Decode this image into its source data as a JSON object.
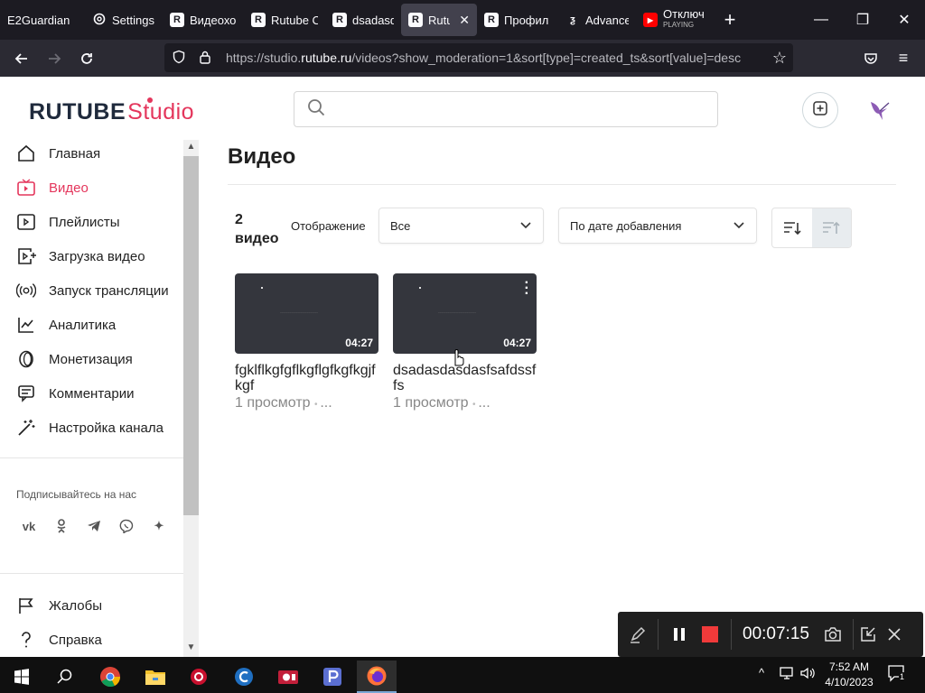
{
  "browser": {
    "tabs": [
      {
        "title": "E2Guardian -",
        "icon": "e2guardian-icon"
      },
      {
        "title": "Settings",
        "icon": "gear-icon"
      },
      {
        "title": "Видеохо",
        "icon": "rutube-icon"
      },
      {
        "title": "Rutube С",
        "icon": "rutube-icon"
      },
      {
        "title": "dsadasda",
        "icon": "rutube-icon"
      },
      {
        "title": "Rutub",
        "icon": "rutube-icon",
        "active": true
      },
      {
        "title": "Профил",
        "icon": "rutube-icon"
      },
      {
        "title": "Advance",
        "icon": "advance-icon"
      },
      {
        "title": "Отключ",
        "subtitle": "PLAYING",
        "icon": "youtube-icon"
      }
    ],
    "url_prefix": "https://studio.",
    "url_domain": "rutube.ru",
    "url_suffix": "/videos?show_moderation=1&sort[type]=created_ts&sort[value]=desc"
  },
  "studio": {
    "logo_main": "RUTUBE",
    "logo_studio": "Studio",
    "search_placeholder": ""
  },
  "sidebar": {
    "items": [
      {
        "label": "Главная",
        "icon": "home-icon"
      },
      {
        "label": "Видео",
        "icon": "video-icon",
        "active": true
      },
      {
        "label": "Плейлисты",
        "icon": "playlist-icon"
      },
      {
        "label": "Загрузка видео",
        "icon": "upload-video-icon"
      },
      {
        "label": "Запуск трансляции",
        "icon": "broadcast-icon"
      },
      {
        "label": "Аналитика",
        "icon": "analytics-icon"
      },
      {
        "label": "Монетизация",
        "icon": "monetization-icon"
      },
      {
        "label": "Комментарии",
        "icon": "comments-icon"
      },
      {
        "label": "Настройка канала",
        "icon": "channel-settings-icon"
      }
    ],
    "follow_label": "Подписывайтесь на нас",
    "social": [
      "vk-icon",
      "ok-icon",
      "telegram-icon",
      "viber-icon",
      "dzen-icon"
    ],
    "bottom_items": [
      {
        "label": "Жалобы",
        "icon": "flag-icon"
      },
      {
        "label": "Справка",
        "icon": "help-icon"
      }
    ]
  },
  "main": {
    "title": "Видео",
    "count_number": "2",
    "count_word": "видео",
    "display_label": "Отображение",
    "filter_value": "Все",
    "sort_value": "По дате добавления",
    "videos": [
      {
        "title": "fgklflkgfgflkgflgfkgfkgjfkgf",
        "duration": "04:27",
        "views": "1 просмотр",
        "more": "..."
      },
      {
        "title": "dsadasdasdasfsafdssffs",
        "duration": "04:27",
        "views": "1 просмотр",
        "more": "..."
      }
    ]
  },
  "recorder": {
    "elapsed": "00:07:15"
  },
  "taskbar": {
    "time": "7:52 AM",
    "date": "4/10/2023",
    "notifications": "1"
  },
  "colors": {
    "accent": "#e4365c",
    "logo_dark": "#1f2a3c",
    "browser_bg": "#1c1b22",
    "nav_bg": "#2b2a33"
  }
}
